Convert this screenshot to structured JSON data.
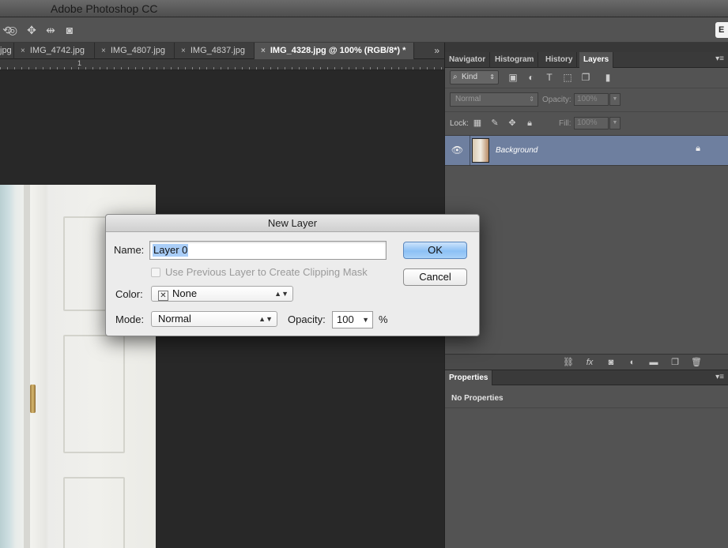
{
  "app": {
    "title": "Adobe Photoshop CC"
  },
  "options_bar": {
    "icons": [
      "rotate-3d-icon",
      "pan-3d-icon",
      "slide-3d-icon",
      "video-camera-icon"
    ],
    "right_button": "E"
  },
  "document_tabs": {
    "tabs": [
      {
        "label": "jpg",
        "close": ""
      },
      {
        "label": "IMG_4742.jpg",
        "close": "×"
      },
      {
        "label": "IMG_4807.jpg",
        "close": "×"
      },
      {
        "label": "IMG_4837.jpg",
        "close": "×"
      },
      {
        "label": "IMG_4328.jpg @ 100% (RGB/8*) *",
        "close": "×"
      }
    ],
    "overflow": "»"
  },
  "ruler": {
    "label": "1"
  },
  "panels": {
    "top_tabs": [
      "Navigator",
      "Histogram",
      "History",
      "Layers"
    ],
    "active_tab": "Layers",
    "menu": "▾≡",
    "layers": {
      "filter_kind": "Kind",
      "blend_mode": "Normal",
      "opacity_label": "Opacity:",
      "opacity_value": "100%",
      "lock_label": "Lock:",
      "fill_label": "Fill:",
      "fill_value": "100%",
      "items": [
        {
          "name": "Background",
          "visible": true,
          "locked": true
        }
      ]
    },
    "properties": {
      "tab": "Properties",
      "message": "No Properties"
    }
  },
  "dialog": {
    "title": "New Layer",
    "name_label": "Name:",
    "name_value": "Layer 0",
    "clip_label": "Use Previous Layer to Create Clipping Mask",
    "color_label": "Color:",
    "color_value": "None",
    "mode_label": "Mode:",
    "mode_value": "Normal",
    "opacity_label": "Opacity:",
    "opacity_value": "100",
    "opacity_unit": "%",
    "ok": "OK",
    "cancel": "Cancel"
  },
  "colors": {
    "selected_layer": "#6e7f9f",
    "panel_bg": "#535353",
    "ok_button": "#8cc0f5"
  }
}
